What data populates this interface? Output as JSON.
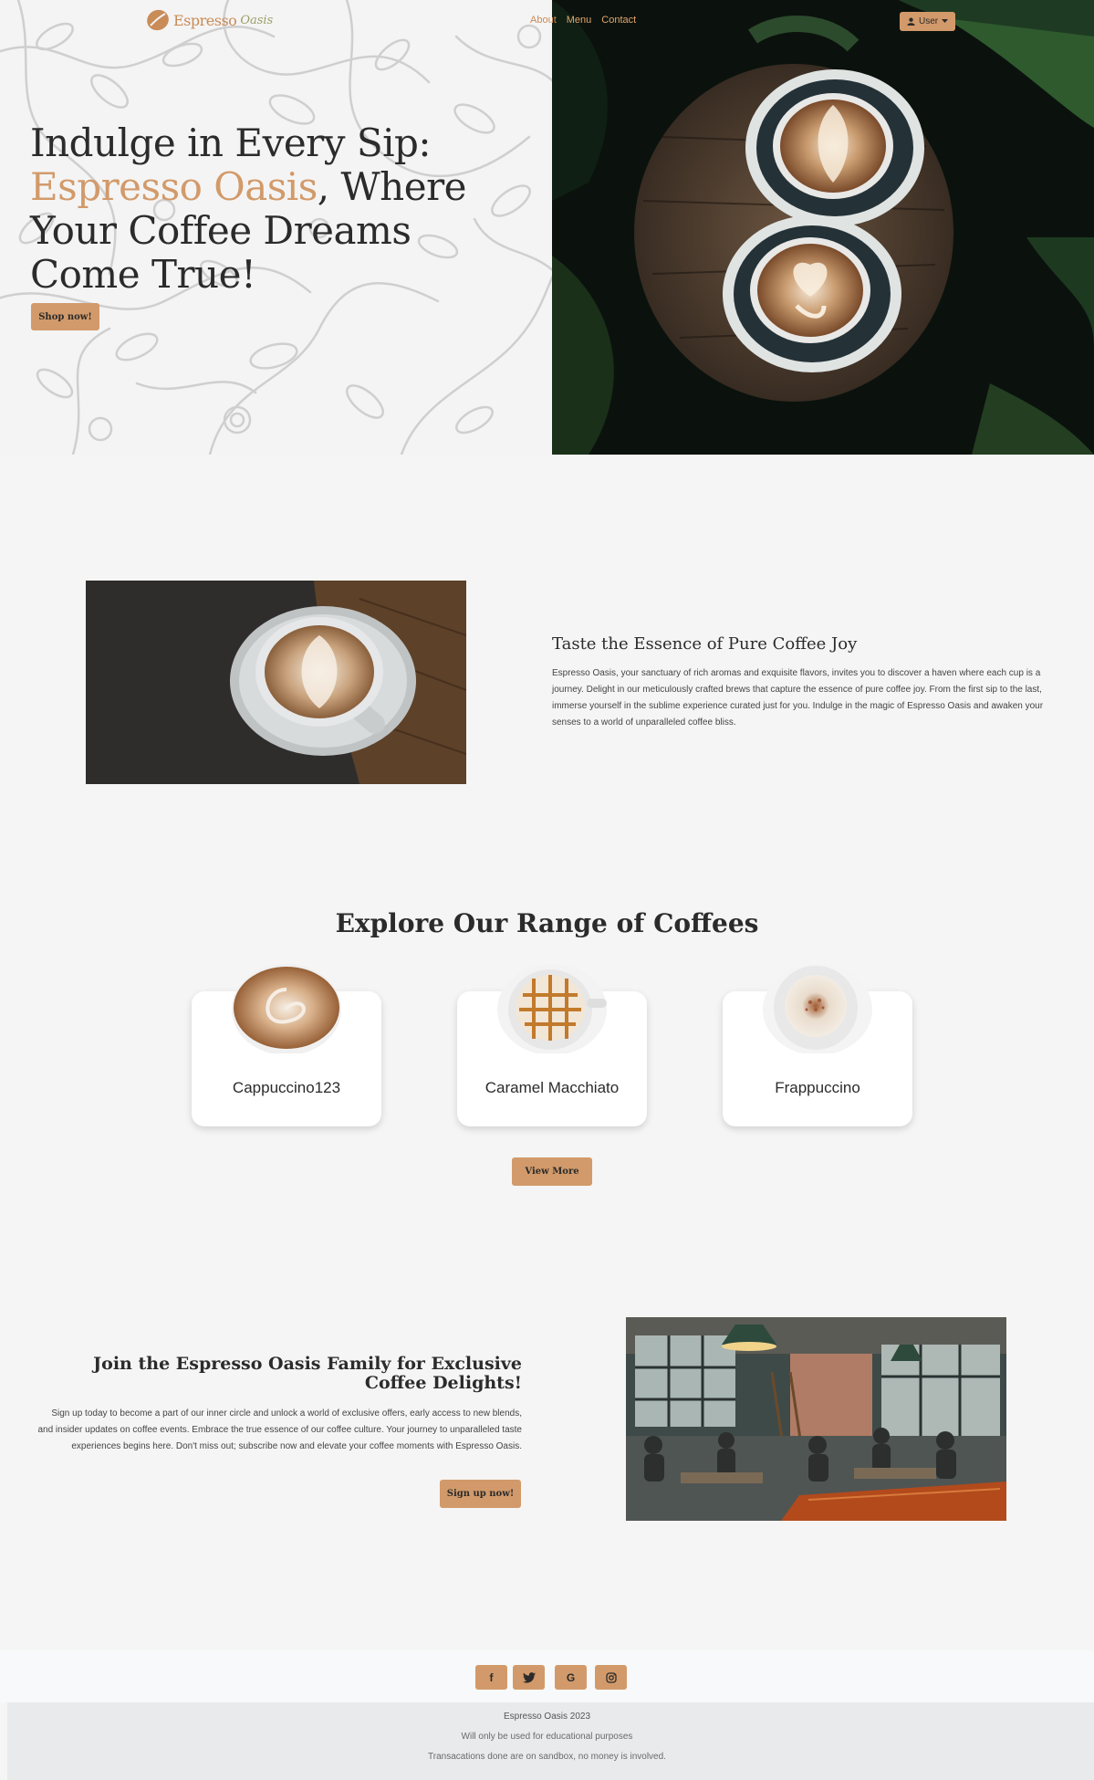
{
  "brand": {
    "name": "Espresso",
    "sub": "Oasis"
  },
  "nav": {
    "items": [
      "About",
      "Menu",
      "Contact"
    ],
    "user_label": "User"
  },
  "hero": {
    "title_line1": "Indulge in Every Sip:",
    "title_accent": "Espresso Oasis",
    "title_rest": ", Where Your Coffee Dreams Come True!",
    "cta": "Shop now!"
  },
  "about": {
    "title": "Taste the Essence of Pure Coffee Joy",
    "text": "Espresso Oasis, your sanctuary of rich aromas and exquisite flavors, invites you to discover a haven where each cup is a journey. Delight in our meticulously crafted brews that capture the essence of pure coffee joy. From the first sip to the last, immerse yourself in the sublime experience curated just for you. Indulge in the magic of Espresso Oasis and awaken your senses to a world of unparalleled coffee bliss."
  },
  "range": {
    "title": "Explore Our Range of Coffees",
    "products": [
      {
        "name": "Cappuccino123"
      },
      {
        "name": "Caramel Macchiato"
      },
      {
        "name": "Frappuccino"
      }
    ],
    "view_more": "View More"
  },
  "join": {
    "title": "Join the Espresso Oasis Family for Exclusive Coffee Delights!",
    "text": "Sign up today to become a part of our inner circle and unlock a world of exclusive offers, early access to new blends, and insider updates on coffee events. Embrace the true essence of our coffee culture. Your journey to unparalleled taste experiences begins here. Don't miss out; subscribe now and elevate your coffee moments with Espresso Oasis.",
    "cta": "Sign up now!"
  },
  "footer": {
    "socials": [
      "f",
      "t",
      "G",
      "o"
    ],
    "copyright": "Espresso Oasis 2023",
    "note1": "Will only be used for educational purposes",
    "note2": "Transacations done are on sandbox, no money is involved."
  },
  "colors": {
    "accent": "#d29a6a",
    "text": "#2b2b2b",
    "background": "#f5f5f5"
  }
}
